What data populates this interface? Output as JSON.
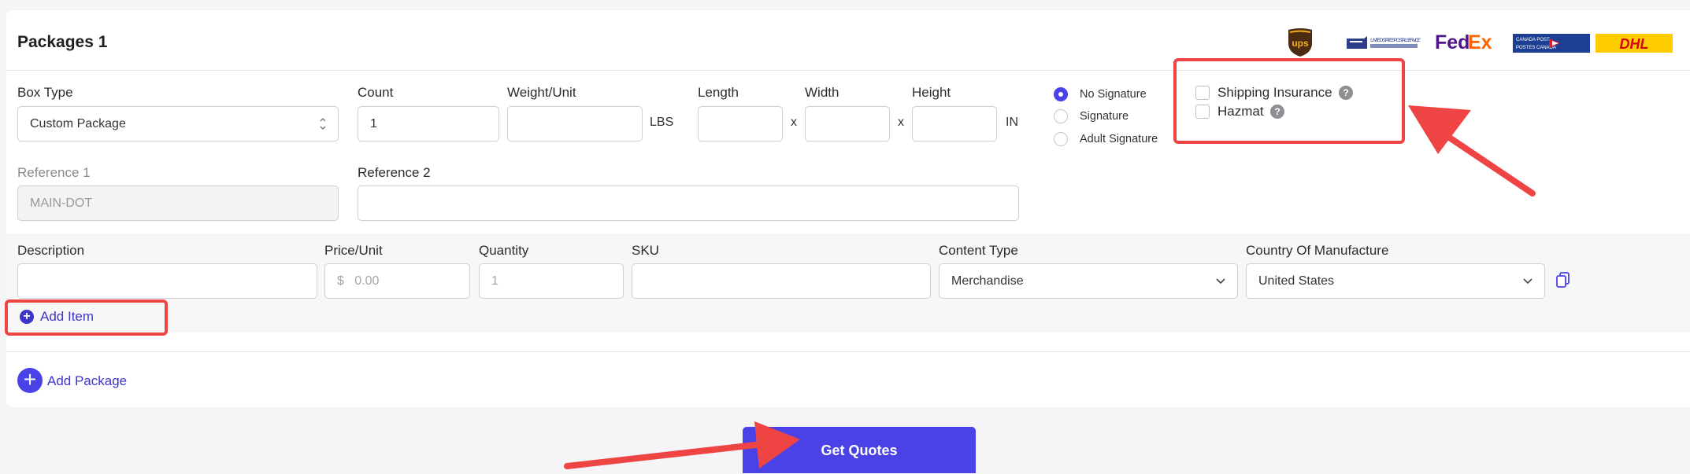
{
  "package": {
    "title": "Packages 1",
    "box_type": {
      "label": "Box Type",
      "value": "Custom Package"
    },
    "count": {
      "label": "Count",
      "value": "1"
    },
    "weight": {
      "label": "Weight/Unit",
      "value": "",
      "unit": "LBS"
    },
    "length": {
      "label": "Length",
      "value": ""
    },
    "width": {
      "label": "Width",
      "value": ""
    },
    "height": {
      "label": "Height",
      "value": "",
      "unit": "IN"
    },
    "dim_sep": "x",
    "signature": {
      "options": [
        "No Signature",
        "Signature",
        "Adult Signature"
      ],
      "selected": "No Signature"
    },
    "extras": {
      "shipping_insurance": "Shipping Insurance",
      "hazmat": "Hazmat",
      "help_glyph": "?"
    },
    "reference1": {
      "label": "Reference 1",
      "value": "MAIN-DOT"
    },
    "reference2": {
      "label": "Reference 2",
      "value": ""
    }
  },
  "carriers": [
    "UPS",
    "United States Postal Service",
    "FedEx",
    "Canada Post",
    "DHL"
  ],
  "carrier_logo_text": {
    "ups": "ups",
    "usps": "UNITED STATES POSTAL SERVICE",
    "fedex_a": "Fed",
    "fedex_b": "Ex",
    "canada_a": "CANADA POST",
    "canada_b": "POSTES CANADA",
    "dhl": "DHL"
  },
  "item": {
    "description": {
      "label": "Description",
      "value": ""
    },
    "price": {
      "label": "Price/Unit",
      "currency": "$",
      "placeholder": "0.00"
    },
    "quantity": {
      "label": "Quantity",
      "placeholder": "1"
    },
    "sku": {
      "label": "SKU",
      "value": ""
    },
    "content_type": {
      "label": "Content Type",
      "value": "Merchandise"
    },
    "country": {
      "label": "Country Of Manufacture",
      "value": "United States"
    }
  },
  "actions": {
    "add_item": "Add Item",
    "add_package": "Add Package",
    "get_quotes": "Get Quotes"
  },
  "colors": {
    "accent": "#4a42e6",
    "annotation": "#ef4444",
    "link": "#3d35c9"
  }
}
